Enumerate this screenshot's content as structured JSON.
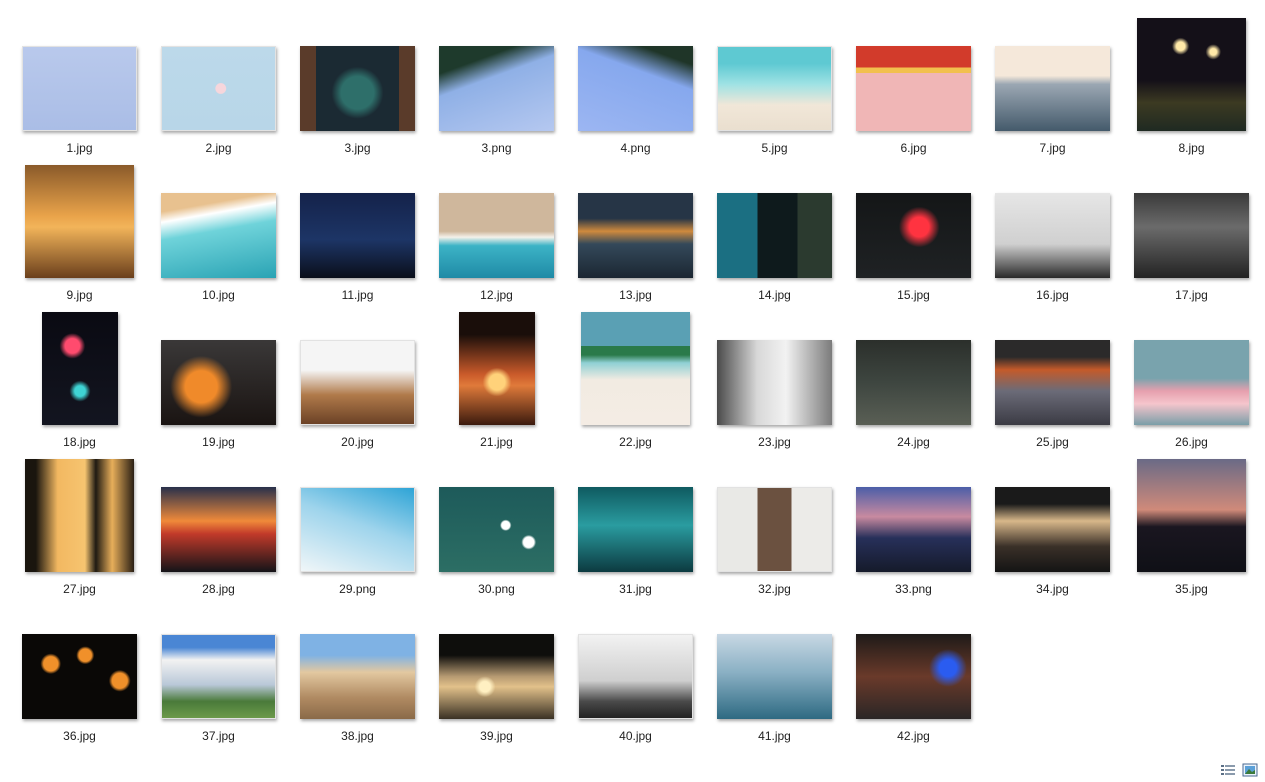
{
  "colors": {
    "label": "#222222",
    "background": "#ffffff"
  },
  "files": [
    {
      "name": "1.jpg",
      "shape": "landscape",
      "bg": "linear-gradient(180deg,#b9c9ec,#aabde6)",
      "light": true
    },
    {
      "name": "2.jpg",
      "shape": "landscape",
      "bg": "radial-gradient(circle at 52% 50%,#f6d6dc 0 7%,transparent 8%),linear-gradient(#bcd9ea,#b8d6e8)",
      "light": true
    },
    {
      "name": "3.jpg",
      "shape": "landscape",
      "bg": "radial-gradient(circle at 50% 55%,#2e6f6a 0 22%,transparent 35%),linear-gradient(90deg,#5a3b2a 0 14%,#1b2a33 14% 86%,#5a3b2a 86%)"
    },
    {
      "name": "3.png",
      "shape": "landscape",
      "bg": "linear-gradient(160deg,#1e3a2c 0 22%,#8fb0e6 40%,#b5c8f0 100%)"
    },
    {
      "name": "4.png",
      "shape": "landscape",
      "bg": "linear-gradient(200deg,#1f3528 0 15%,#86a8ee 35%,#9cb6f2 100%)"
    },
    {
      "name": "5.jpg",
      "shape": "landscape",
      "bg": "linear-gradient(180deg,#5ec9d2 0 20%,#9fe2e4 45%,#f1e7d8 70%,#eadfcf 100%)",
      "light": true
    },
    {
      "name": "6.jpg",
      "shape": "landscape",
      "bg": "linear-gradient(180deg,#d23b2b 0 25%,#f2c04e 25% 32%,#f0b6b6 32% 100%)"
    },
    {
      "name": "7.jpg",
      "shape": "landscape",
      "bg": "linear-gradient(180deg,#f5e8da 0 35%,#9ba7b3 45%,#445a6b 100%)"
    },
    {
      "name": "8.jpg",
      "shape": "portrait-wide",
      "bg": "radial-gradient(circle at 40% 25%,#ffe9a8 0 4%,transparent 8%),radial-gradient(circle at 70% 30%,#ffe9a8 0 3%,transparent 7%),linear-gradient(180deg,#141018 0 55%,#3c3a22 75%,#1f2a22 100%)"
    },
    {
      "name": "9.jpg",
      "shape": "portrait-wide",
      "bg": "linear-gradient(180deg,#8a5a2a 0%,#e9a34a 45%,#f2b45a 55%,#6a3f1c 100%)"
    },
    {
      "name": "10.jpg",
      "shape": "landscape",
      "bg": "linear-gradient(170deg,#e8c18f 0 18%,#ffffff 28%,#6fd3da 45%,#2aa3b4 100%)"
    },
    {
      "name": "11.jpg",
      "shape": "landscape",
      "bg": "linear-gradient(180deg,#14224a 0%,#1d3566 55%,#0a0f1a 100%)"
    },
    {
      "name": "12.jpg",
      "shape": "landscape",
      "bg": "linear-gradient(180deg,#cfb79c 0 45%,#f4f1ea 52%,#3cb3c6 62%,#1f8aa6 100%)"
    },
    {
      "name": "13.jpg",
      "shape": "landscape",
      "bg": "linear-gradient(180deg,#263546 0 30%,#cf8a3d 45%,#34495a 60%,#1b2632 100%)"
    },
    {
      "name": "14.jpg",
      "shape": "landscape",
      "bg": "linear-gradient(90deg,#1b6f82 0 35%,#0e1a1c 35% 70%,#2b3a2f 70%)"
    },
    {
      "name": "15.jpg",
      "shape": "landscape",
      "bg": "radial-gradient(circle at 55% 40%,#ff3340 0 12%,transparent 25%),linear-gradient(180deg,#141617,#1f2224)"
    },
    {
      "name": "16.jpg",
      "shape": "landscape",
      "bg": "linear-gradient(180deg,#e6e6e6 0%,#d0d0d0 60%,#2a2a2a 100%)"
    },
    {
      "name": "17.jpg",
      "shape": "landscape",
      "bg": "linear-gradient(180deg,#3a3a3a 0%,#6b6b6b 40%,#232323 100%)"
    },
    {
      "name": "18.jpg",
      "shape": "portrait-narrow",
      "bg": "radial-gradient(circle at 40% 30%,#ff4b6e 0 8%,transparent 14%),radial-gradient(circle at 50% 70%,#3fd4d4 0 6%,transparent 12%),linear-gradient(180deg,#0a0a12,#131520)"
    },
    {
      "name": "19.jpg",
      "shape": "landscape",
      "bg": "radial-gradient(circle at 35% 55%,#f08a2a 0 18%,transparent 35%),linear-gradient(180deg,#3a3838,#1a1412)"
    },
    {
      "name": "20.jpg",
      "shape": "landscape",
      "bg": "linear-gradient(180deg,#f5f5f5 0 35%,#b07a4a 65%,#6b4126 100%)",
      "light": true
    },
    {
      "name": "21.jpg",
      "shape": "portrait-narrow",
      "bg": "radial-gradient(circle at 50% 62%,#ffd27a 0 10%,transparent 18%),linear-gradient(180deg,#1a0e0a 0 20%,#c95a2a 55%,#e07a3a 65%,#3b1a0e 100%)"
    },
    {
      "name": "22.jpg",
      "shape": "portrait-wide",
      "bg": "linear-gradient(180deg,#5aa0b4 0 30%,#2a7a4a 30% 38%,#8fd0d4 45%,#f2ebe2 60%,#f4ece4 100%)"
    },
    {
      "name": "23.jpg",
      "shape": "landscape",
      "bg": "linear-gradient(90deg,#4a4a4a 0%,#d8d8d8 35%,#f2f2f2 60%,#7b7b7b 100%)"
    },
    {
      "name": "24.jpg",
      "shape": "landscape",
      "bg": "linear-gradient(180deg,#2b2f2b 0%,#3e4640 50%,#5a5f55 100%)"
    },
    {
      "name": "25.jpg",
      "shape": "landscape",
      "bg": "linear-gradient(180deg,#2b2a2a 0 20%,#c45a2a 35%,#6b6b78 60%,#3b3b44 100%)"
    },
    {
      "name": "26.jpg",
      "shape": "landscape",
      "bg": "linear-gradient(180deg,#79a3ad 0 45%,#e6a0ae 60%,#f5c5cc 75%,#7a9ea8 100%)"
    },
    {
      "name": "27.jpg",
      "shape": "portrait-wide",
      "bg": "linear-gradient(90deg,#1a150e 0 10%,#f2b861 30%,#f6c470 55%,#1f1a12 65%,#e7ae5a 80%,#2a1f14 100%)"
    },
    {
      "name": "28.jpg",
      "shape": "landscape",
      "bg": "linear-gradient(180deg,#27304b 0%,#f08a3a 40%,#c23a2a 55%,#141418 100%)"
    },
    {
      "name": "29.png",
      "shape": "landscape",
      "bg": "linear-gradient(200deg,#2ea4d6 0%,#9ed4ec 45%,#f0f6f8 100%)",
      "light": true
    },
    {
      "name": "30.png",
      "shape": "landscape",
      "bg": "radial-gradient(circle at 58% 45%,#ffffff 0 5%,transparent 7%),radial-gradient(circle at 78% 65%,#ffffff 0 5%,transparent 7%),linear-gradient(180deg,#1d5a5a,#2c6e64)"
    },
    {
      "name": "31.jpg",
      "shape": "landscape",
      "bg": "linear-gradient(180deg,#0f5a60 0%,#2a9ca0 45%,#0c3a40 100%)"
    },
    {
      "name": "32.jpg",
      "shape": "landscape",
      "bg": "linear-gradient(90deg,#e9e9e6 0 35%,#6b5140 35% 65%,#ecebe8 65%)",
      "light": true
    },
    {
      "name": "33.png",
      "shape": "landscape",
      "bg": "linear-gradient(180deg,#4b5ea8 0%,#c88aa0 35%,#27305a 60%,#151a2a 100%)"
    },
    {
      "name": "34.jpg",
      "shape": "landscape",
      "bg": "linear-gradient(180deg,#1a1a1a 0 20%,#d8b88a 40%,#3a3028 70%,#141414 100%)"
    },
    {
      "name": "35.jpg",
      "shape": "portrait-wide",
      "bg": "linear-gradient(180deg,#6a6a86 0%,#d08a7a 45%,#1a1620 60%,#0f1016 100%)"
    },
    {
      "name": "36.jpg",
      "shape": "landscape",
      "bg": "radial-gradient(circle at 25% 35%,#f0902a 0 7%,transparent 10%),radial-gradient(circle at 55% 25%,#f0902a 0 7%,transparent 10%),radial-gradient(circle at 85% 55%,#f0902a 0 7%,transparent 10%),linear-gradient(#0a0806,#0a0806)"
    },
    {
      "name": "37.jpg",
      "shape": "landscape",
      "bg": "linear-gradient(180deg,#4a86d4 0 15%,#f2f2f2 30%,#b9c8d8 60%,#4a7a3a 80%,#6c9a4a 100%)",
      "light": true
    },
    {
      "name": "38.jpg",
      "shape": "landscape",
      "bg": "linear-gradient(180deg,#7fb2e4 0 25%,#e3c8a0 45%,#b08a62 75%,#8a6a48 100%)"
    },
    {
      "name": "39.jpg",
      "shape": "landscape",
      "bg": "radial-gradient(circle at 40% 62%,#fff0c2 0 6%,transparent 12%),linear-gradient(180deg,#0e0e0c 0 25%,#b69a72 50%,#e2c18a 62%,#3a3124 100%)"
    },
    {
      "name": "40.jpg",
      "shape": "landscape",
      "bg": "linear-gradient(180deg,#f2f2f2 0%,#cfcfcf 55%,#4a4a4a 80%,#222222 100%)",
      "light": true
    },
    {
      "name": "41.jpg",
      "shape": "landscape",
      "bg": "linear-gradient(180deg,#c8d8e4 0%,#8ab0c4 45%,#2e6a82 100%)"
    },
    {
      "name": "42.jpg",
      "shape": "landscape",
      "bg": "radial-gradient(circle at 80% 40%,#2a5cf0 0 8%,transparent 18%),linear-gradient(180deg,#1e1a18 0%,#6a3a2a 50%,#2a2626 100%)"
    }
  ]
}
